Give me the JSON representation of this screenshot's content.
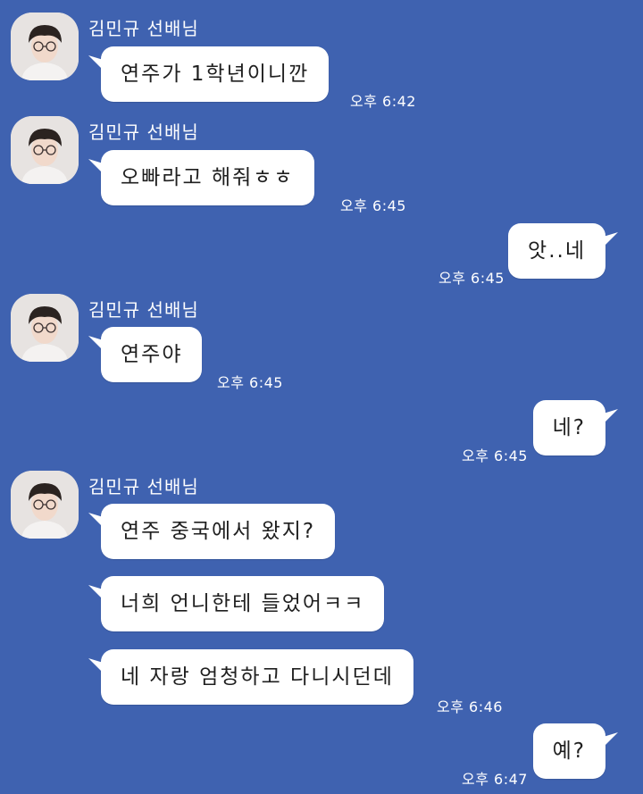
{
  "chat": {
    "contact_name": "김민규 선배님",
    "ampm": "오후",
    "messages": [
      {
        "from": "them",
        "text": "연주가 1학년이니깐",
        "time": "오후 6:42"
      },
      {
        "from": "them",
        "text": "오빠라고 해줘ㅎㅎ",
        "time": "오후 6:45"
      },
      {
        "from": "me",
        "text": "앗..네",
        "time": "오후 6:45"
      },
      {
        "from": "them",
        "text": "연주야",
        "time": "오후 6:45"
      },
      {
        "from": "me",
        "text": "네?",
        "time": "오후 6:45"
      },
      {
        "from": "them",
        "text": "연주 중국에서 왔지?",
        "time": ""
      },
      {
        "from": "them",
        "text": "너희 언니한테 들었어ㅋㅋ",
        "time": ""
      },
      {
        "from": "them",
        "text": "네 자랑 엄청하고 다니시던데",
        "time": "오후 6:46"
      },
      {
        "from": "me",
        "text": "예?",
        "time": "오후 6:47"
      }
    ]
  },
  "colors": {
    "background": "#3f62b0",
    "bubble": "#ffffff",
    "text": "#1f1f1f"
  },
  "icons": {
    "avatar": "profile-photo"
  }
}
